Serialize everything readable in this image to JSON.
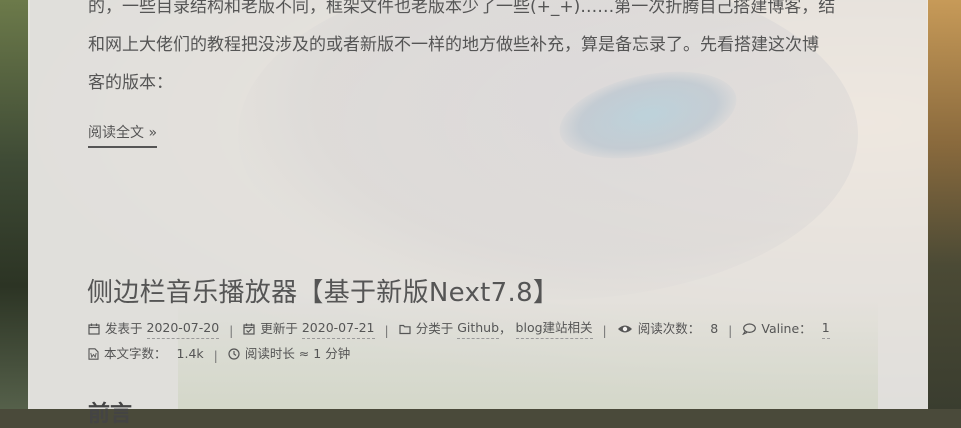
{
  "excerpt": {
    "line1": "的，一些目录结构和老版不同，框架文件也老版本少了一些(+_+)……第一次折腾自己搭建博客，结",
    "line2": "和网上大佬们的教程把没涉及的或者新版不一样的地方做些补充，算是备忘录了。先看搭建这次博",
    "line3": "客的版本："
  },
  "read_more": "阅读全文 »",
  "post": {
    "title": "侧边栏音乐播放器【基于新版Next7.8】",
    "posted_label": "发表于",
    "posted_date": "2020-07-20",
    "updated_label": "更新于",
    "updated_date": "2020-07-21",
    "category_label": "分类于",
    "category1": "Github",
    "category_sep": "，",
    "category2": "blog建站相关",
    "views_label": "阅读次数：",
    "views_count": "8",
    "comments_label": "Valine：",
    "comments_count": "1",
    "wordcount_label": "本文字数：",
    "wordcount_value": "1.4k",
    "readtime_label": "阅读时长 ≈",
    "readtime_value": "1 分钟"
  },
  "next_heading": "前言",
  "icons": {
    "calendar": "calendar-icon",
    "calendar_check": "calendar-check-icon",
    "folder": "folder-icon",
    "eye": "eye-icon",
    "comment": "comment-icon",
    "file_word": "file-word-icon",
    "clock": "clock-icon"
  },
  "colors": {
    "text": "#555555",
    "panel": "#f4f2f0"
  }
}
